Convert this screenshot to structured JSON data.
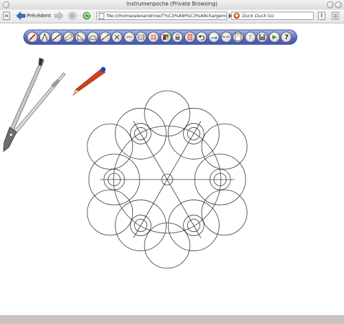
{
  "window": {
    "title": "Instrumenpoche (Private Browsing)"
  },
  "navigation": {
    "back_label": "Précédent",
    "url": "file:///home/alexandrine/T%C3%A9l%C3%A9chargeme",
    "search_placeholder": "Duck Duck Go"
  },
  "toolbar": {
    "tools": [
      {
        "name": "pencil-tool-icon",
        "glyph": "pencil"
      },
      {
        "name": "compass-tool-icon",
        "glyph": "compass"
      },
      {
        "name": "line-tool-icon",
        "glyph": "line"
      },
      {
        "name": "ruler-tool-icon",
        "glyph": "ruler"
      },
      {
        "name": "set-square-icon",
        "glyph": "square"
      },
      {
        "name": "protractor-icon",
        "glyph": "protractor"
      },
      {
        "name": "segment-tool-icon",
        "glyph": "segment"
      },
      {
        "name": "point-tool-icon",
        "glyph": "point"
      },
      {
        "name": "label-tool-icon",
        "glyph": "label",
        "text": "abc"
      },
      {
        "name": "measure-tool-icon",
        "glyph": "measure"
      },
      {
        "name": "grid-tool-icon",
        "glyph": "grid"
      },
      {
        "name": "color-tool-icon",
        "glyph": "color"
      },
      {
        "name": "lock-tool-icon",
        "glyph": "lock"
      },
      {
        "name": "eraser-tool-icon",
        "glyph": "eraser"
      },
      {
        "name": "undo-tool-icon",
        "glyph": "undo"
      },
      {
        "name": "redo-tool-icon",
        "glyph": "redo"
      },
      {
        "name": "animation-tool-icon",
        "glyph": "anim",
        "text": "Anim"
      },
      {
        "name": "zoom-tool-icon",
        "glyph": "zoom"
      },
      {
        "name": "text-tool-icon",
        "glyph": "text",
        "text": "T"
      },
      {
        "name": "save-tool-icon",
        "glyph": "save"
      },
      {
        "name": "play-tool-icon",
        "glyph": "play"
      },
      {
        "name": "help-tool-icon",
        "glyph": "help",
        "text": "?"
      }
    ]
  },
  "colors": {
    "toolbar": "#5568c6",
    "pencil_body": "#d2401c",
    "pencil_eraser": "#1a3fd6",
    "drawing_stroke": "#333333",
    "statusbar": "#cbc3c3"
  }
}
